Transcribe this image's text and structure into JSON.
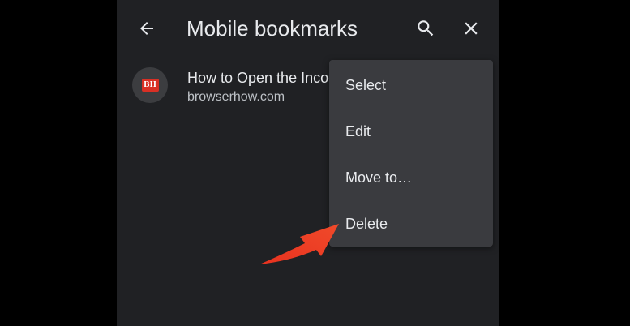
{
  "toolbar": {
    "title": "Mobile bookmarks",
    "back_icon": "arrow-back-icon",
    "search_icon": "search-icon",
    "close_icon": "close-icon"
  },
  "bookmark": {
    "favicon_text": "BH",
    "title": "How to Open the Incognito",
    "url": "browserhow.com"
  },
  "menu": {
    "items": [
      {
        "label": "Select"
      },
      {
        "label": "Edit"
      },
      {
        "label": "Move to…"
      },
      {
        "label": "Delete"
      }
    ]
  },
  "annotation": {
    "arrow_color": "#e8321f"
  },
  "colors": {
    "background": "#202124",
    "menu_background": "#3a3b3f",
    "text_primary": "#e8eaed",
    "text_secondary": "#bdc1c6",
    "favicon_red": "#d93025"
  }
}
